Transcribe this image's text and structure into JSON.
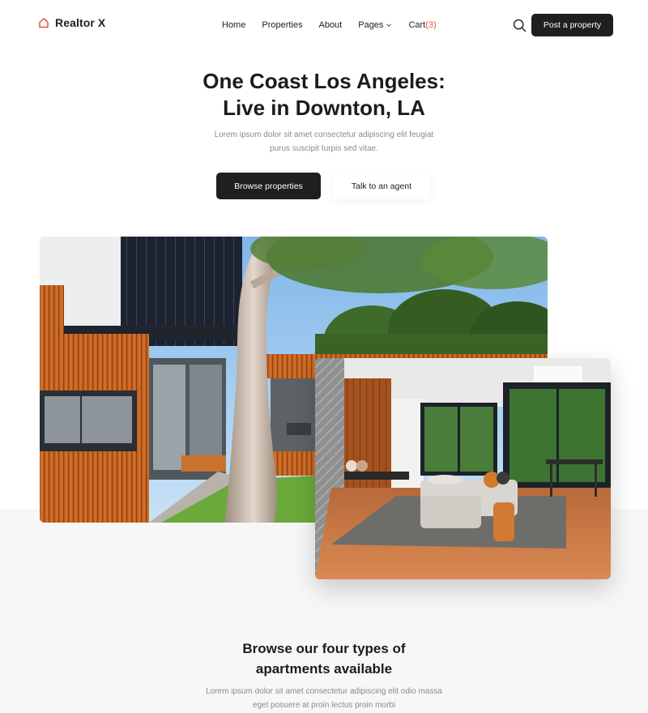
{
  "header": {
    "brand": "Realtor X",
    "nav": [
      {
        "label": "Home"
      },
      {
        "label": "Properties"
      },
      {
        "label": "About"
      },
      {
        "label": "Pages"
      },
      {
        "label": "Cart",
        "count": "(3)"
      }
    ],
    "post_label": "Post a property"
  },
  "hero": {
    "title_line1": "One Coast Los Angeles:",
    "title_line2": "Live in Downton, LA",
    "subtitle_line1": "Lorem ipsum dolor sit amet consectetur adipiscing elit feugiat",
    "subtitle_line2": "purus suscipit turpis sed vitae.",
    "browse_label": "Browse properties",
    "agent_label": "Talk to an agent"
  },
  "section": {
    "title_line1": "Browse our four types of",
    "title_line2": "apartments available",
    "subtitle_line1": "Lorem ipsum dolor sit amet consectetur adipiscing elit odio massa",
    "subtitle_line2": "eget posuere at proin lectus proin morbi"
  },
  "colors": {
    "accent": "#e0543f",
    "dark": "#1f1f1f",
    "muted_text": "#8a8a8a",
    "lower_background": "#f7f7f8"
  },
  "icons": {
    "logo": "house-outline-icon",
    "search": "search-icon",
    "pages_dropdown": "chevron-down-icon"
  }
}
